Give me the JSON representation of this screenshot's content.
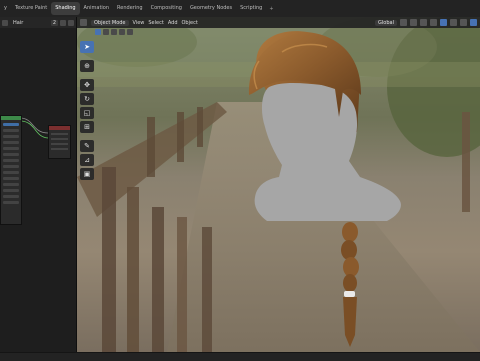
{
  "workspace_tabs": [
    {
      "label": "y",
      "active": false
    },
    {
      "label": "Texture Paint",
      "active": false
    },
    {
      "label": "Shading",
      "active": true
    },
    {
      "label": "Animation",
      "active": false
    },
    {
      "label": "Rendering",
      "active": false
    },
    {
      "label": "Compositing",
      "active": false
    },
    {
      "label": "Geometry Nodes",
      "active": false
    },
    {
      "label": "Scripting",
      "active": false
    }
  ],
  "add_tab": "+",
  "node_editor": {
    "material_name": "Hair",
    "user_count": "2"
  },
  "viewport": {
    "mode": "Object Mode",
    "menus": [
      "View",
      "Select",
      "Add",
      "Object"
    ],
    "orientation": "Global"
  },
  "toolbar": {
    "tools": [
      {
        "name": "select-tool",
        "glyph": "➤",
        "active": true
      },
      {
        "name": "cursor-tool",
        "glyph": "⊕",
        "active": false
      },
      {
        "name": "move-tool",
        "glyph": "✥",
        "active": false
      },
      {
        "name": "rotate-tool",
        "glyph": "↻",
        "active": false
      },
      {
        "name": "scale-tool",
        "glyph": "◱",
        "active": false
      },
      {
        "name": "transform-tool",
        "glyph": "⊞",
        "active": false
      },
      {
        "name": "annotate-tool",
        "glyph": "✎",
        "active": false
      },
      {
        "name": "measure-tool",
        "glyph": "⊿",
        "active": false
      },
      {
        "name": "add-cube-tool",
        "glyph": "▣",
        "active": false
      }
    ]
  },
  "colors": {
    "accent": "#4772b3",
    "node_green": "#3d8a49",
    "hair": "#8a5a2c",
    "mannequin": "#a6a6a6"
  }
}
